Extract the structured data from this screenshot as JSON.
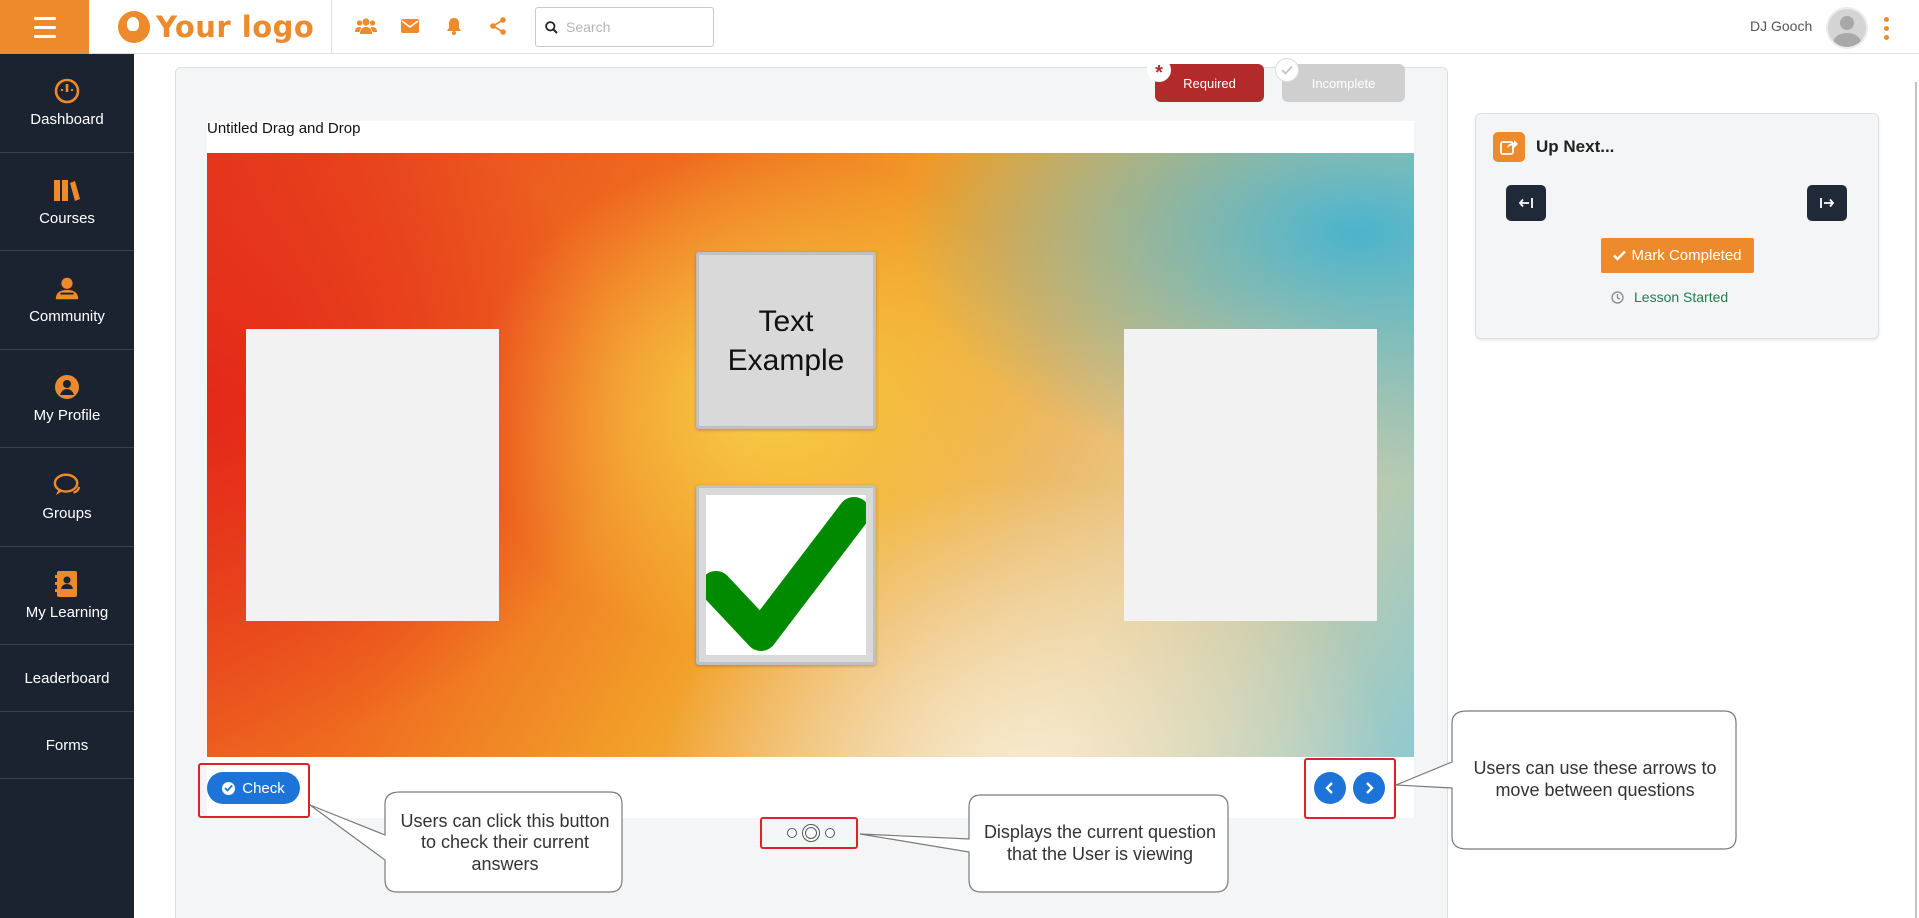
{
  "header": {
    "logo_text": "Your logo",
    "search_placeholder": "Search",
    "user_name": "DJ Gooch",
    "icons": [
      "users-icon",
      "envelope-icon",
      "bell-icon",
      "share-icon"
    ]
  },
  "sidebar": {
    "items": [
      {
        "label": "Dashboard",
        "icon": "dashboard-icon"
      },
      {
        "label": "Courses",
        "icon": "books-icon"
      },
      {
        "label": "Community",
        "icon": "community-icon"
      },
      {
        "label": "My Profile",
        "icon": "user-circle-icon"
      },
      {
        "label": "Groups",
        "icon": "chat-bubbles-icon"
      },
      {
        "label": "My Learning",
        "icon": "contact-book-icon"
      },
      {
        "label": "Leaderboard"
      },
      {
        "label": "Forms"
      }
    ]
  },
  "lesson": {
    "required_label": "Required",
    "incomplete_label": "Incomplete",
    "activity_title": "Untitled Drag and Drop",
    "drag_text": "Text Example",
    "check_label": "Check",
    "pagination": {
      "total": 3,
      "current": 2
    }
  },
  "callouts": {
    "check": "Users can click this button to check their current answers",
    "pagination": "Displays the current question that the User is viewing",
    "arrows": "Users can use these arrows to move between questions"
  },
  "up_next": {
    "title": "Up Next...",
    "mark_completed_label": "Mark Completed",
    "status_label": "Lesson Started"
  },
  "colors": {
    "brand_orange": "#ec8a2c",
    "sidebar_bg": "#1b2331",
    "primary_blue": "#1d74d8",
    "required_red": "#b22a2a",
    "highlight_red": "#e0202b",
    "status_green": "#1e7f4f"
  }
}
